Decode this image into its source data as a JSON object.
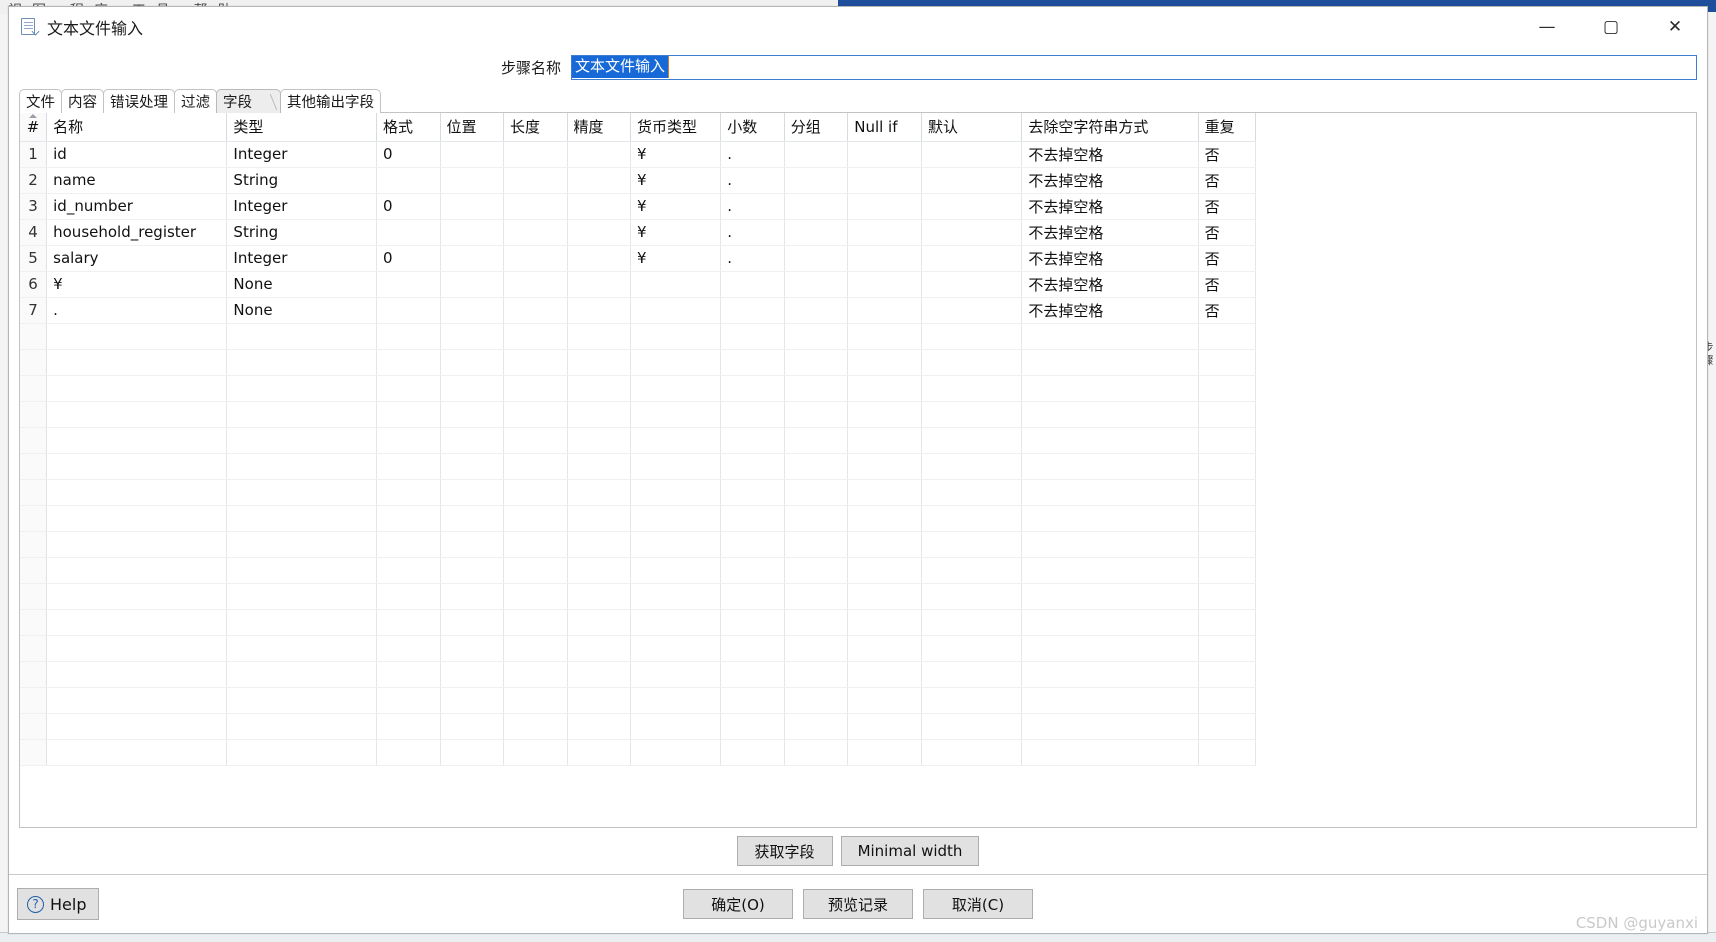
{
  "background": {
    "menubar_text": "视图 程序 工具 帮助",
    "right_rail_text": "步骤"
  },
  "window": {
    "title": "文本文件输入",
    "icon": "text-file-input-icon",
    "controls": {
      "minimize": "—",
      "maximize": "▢",
      "close": "✕"
    }
  },
  "step_name": {
    "label": "步骤名称",
    "value": "文本文件输入",
    "placeholder": ""
  },
  "tabs": [
    {
      "label": "文件",
      "active": false
    },
    {
      "label": "内容",
      "active": false
    },
    {
      "label": "错误处理",
      "active": false
    },
    {
      "label": "过滤",
      "active": false
    },
    {
      "label": "字段",
      "active": true
    },
    {
      "label": "其他输出字段",
      "active": false
    }
  ],
  "fields_table": {
    "columns": [
      "#",
      "名称",
      "类型",
      "格式",
      "位置",
      "长度",
      "精度",
      "货币类型",
      "小数",
      "分组",
      "Null if",
      "默认",
      "去除空字符串方式",
      "重复"
    ],
    "rows": [
      {
        "index": "1",
        "name": "id",
        "type": "Integer",
        "format": "0",
        "position": "",
        "length": "",
        "precision": "",
        "currency": "¥",
        "decimal": ".",
        "group": "",
        "null_if": "",
        "default": "",
        "trim": "不去掉空格",
        "repeat": "否"
      },
      {
        "index": "2",
        "name": "name",
        "type": "String",
        "format": "",
        "position": "",
        "length": "",
        "precision": "",
        "currency": "¥",
        "decimal": ".",
        "group": "",
        "null_if": "",
        "default": "",
        "trim": "不去掉空格",
        "repeat": "否"
      },
      {
        "index": "3",
        "name": "id_number",
        "type": "Integer",
        "format": "0",
        "position": "",
        "length": "",
        "precision": "",
        "currency": "¥",
        "decimal": ".",
        "group": "",
        "null_if": "",
        "default": "",
        "trim": "不去掉空格",
        "repeat": "否"
      },
      {
        "index": "4",
        "name": "household_register",
        "type": "String",
        "format": "",
        "position": "",
        "length": "",
        "precision": "",
        "currency": "¥",
        "decimal": ".",
        "group": "",
        "null_if": "",
        "default": "",
        "trim": "不去掉空格",
        "repeat": "否"
      },
      {
        "index": "5",
        "name": "salary",
        "type": "Integer",
        "format": "0",
        "position": "",
        "length": "",
        "precision": "",
        "currency": "¥",
        "decimal": ".",
        "group": "",
        "null_if": "",
        "default": "",
        "trim": "不去掉空格",
        "repeat": "否"
      },
      {
        "index": "6",
        "name": "¥",
        "type": "None",
        "format": "",
        "position": "",
        "length": "",
        "precision": "",
        "currency": "",
        "decimal": "",
        "group": "",
        "null_if": "",
        "default": "",
        "trim": "不去掉空格",
        "repeat": "否"
      },
      {
        "index": "7",
        "name": ".",
        "type": "None",
        "format": "",
        "position": "",
        "length": "",
        "precision": "",
        "currency": "",
        "decimal": "",
        "group": "",
        "null_if": "",
        "default": "",
        "trim": "不去掉空格",
        "repeat": "否"
      }
    ]
  },
  "mid_buttons": {
    "get_fields": "获取字段",
    "minimal_width": "Minimal width"
  },
  "bottom_bar": {
    "help": "Help",
    "ok": "确定(O)",
    "preview": "预览记录",
    "cancel": "取消(C)",
    "watermark": "CSDN @guyanxi"
  },
  "colors": {
    "selection_blue": "#1669d6",
    "focus_border": "#3c7fd0",
    "titlebar_accent": "#1f4e9c",
    "button_face": "#e1e1e1"
  }
}
